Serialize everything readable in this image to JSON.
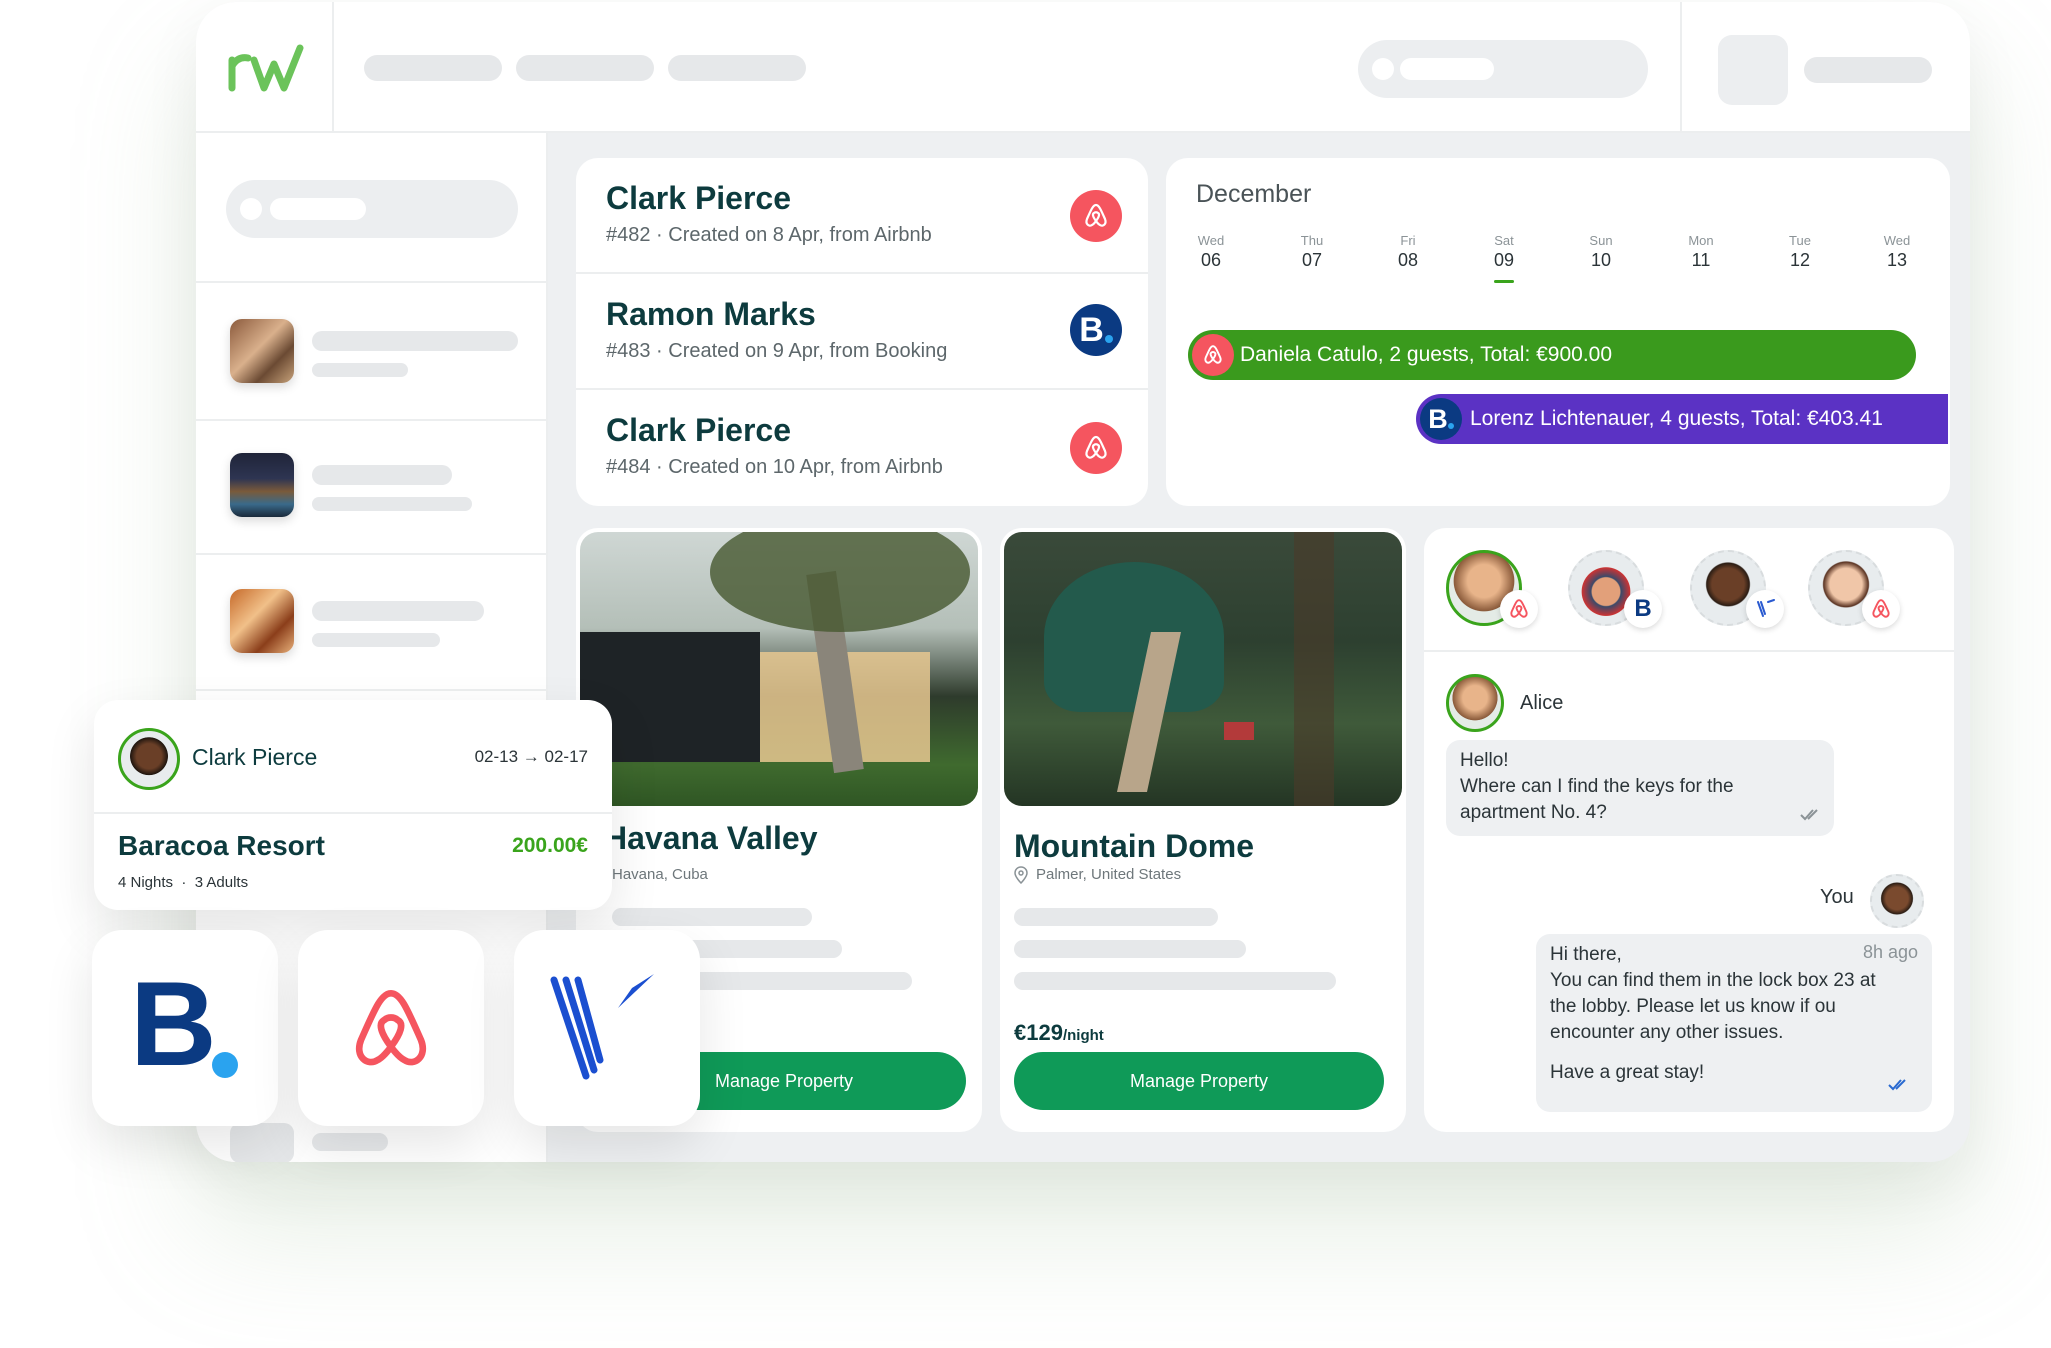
{
  "bookings": [
    {
      "name": "Clark Pierce",
      "sub": "#482 · Created on 8 Apr, from Airbnb",
      "source": "airbnb"
    },
    {
      "name": "Ramon Marks",
      "sub": "#483 · Created on 9 Apr, from Booking",
      "source": "booking"
    },
    {
      "name": "Clark Pierce",
      "sub": "#484 · Created on 10 Apr, from Airbnb",
      "source": "airbnb"
    }
  ],
  "calendar": {
    "month": "December",
    "days": [
      {
        "name": "Wed",
        "date": "06"
      },
      {
        "name": "Thu",
        "date": "07"
      },
      {
        "name": "Fri",
        "date": "08"
      },
      {
        "name": "Sat",
        "date": "09"
      },
      {
        "name": "Sun",
        "date": "10"
      },
      {
        "name": "Mon",
        "date": "11"
      },
      {
        "name": "Tue",
        "date": "12"
      },
      {
        "name": "Wed",
        "date": "13"
      }
    ],
    "reservations": [
      {
        "label": "Daniela Catulo, 2 guests, Total: €900.00",
        "source": "airbnb",
        "color": "#3a9a1d"
      },
      {
        "label": "Lorenz Lichtenauer, 4 guests, Total: €403.41",
        "source": "booking",
        "color": "#5b32c4"
      }
    ]
  },
  "properties": [
    {
      "title": "Havana Valley",
      "location": "Havana, Cuba",
      "button": "Manage Property"
    },
    {
      "title": "Mountain Dome",
      "location": "Palmer, United States",
      "price": "€129",
      "price_unit": "/night",
      "button": "Manage Property"
    }
  ],
  "chat": {
    "sender_name": "Alice",
    "incoming": [
      "Hello!",
      "Where can I find the keys for the",
      "apartment No. 4?"
    ],
    "you_label": "You",
    "outgoing_greeting": "Hi there,",
    "outgoing_time": "8h ago",
    "outgoing_lines": [
      "You can find them in the lock box 23 at",
      "the lobby. Please let us know if ou",
      "encounter any other issues."
    ],
    "outgoing_sign": "Have a great stay!"
  },
  "reservation_card": {
    "guest": "Clark Pierce",
    "dates": "02-13 → 02-17",
    "property": "Baracoa Resort",
    "price": "200.00€",
    "details": "4 Nights  ·  3 Adults"
  },
  "channel_logos": [
    "booking-logo",
    "airbnb-logo",
    "vrbo-logo"
  ],
  "colors": {
    "brand_green": "#0f9a58",
    "airbnb": "#f5555f",
    "booking": "#0b3a82",
    "price_green": "#3aa41c"
  }
}
